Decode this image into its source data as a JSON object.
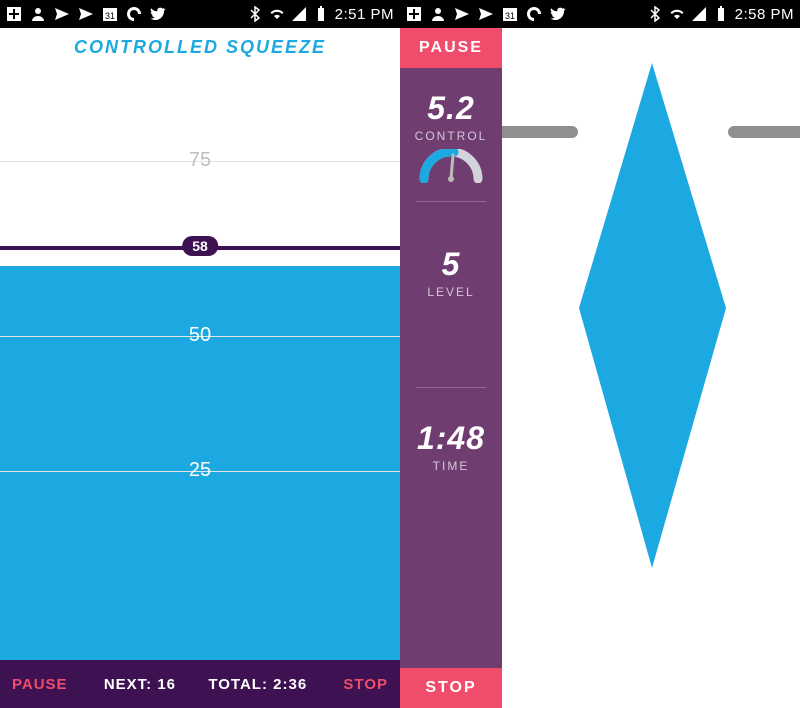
{
  "left": {
    "statusbar": {
      "time": "2:51 PM"
    },
    "title": "CONTROLLED SQUEEZE",
    "chart": {
      "scale_labels": {
        "y75": "75",
        "y50": "50",
        "y25": "25"
      },
      "marker_value": "58"
    },
    "bottombar": {
      "pause": "PAUSE",
      "next_label": "NEXT:",
      "next_value": "16",
      "total_label": "TOTAL:",
      "total_value": "2:36",
      "stop": "STOP"
    }
  },
  "right": {
    "statusbar": {
      "time": "2:58 PM"
    },
    "buttons": {
      "pause": "PAUSE",
      "stop": "STOP"
    },
    "metrics": {
      "control_value": "5.2",
      "control_label": "CONTROL",
      "level_value": "5",
      "level_label": "LEVEL",
      "time_value": "1:48",
      "time_label": "TIME"
    }
  },
  "chart_data": [
    {
      "type": "area",
      "title": "CONTROLLED SQUEEZE",
      "ylabel": "",
      "xlabel": "",
      "ylim": [
        0,
        100
      ],
      "current_value": 58,
      "gridlines": [
        25,
        50,
        75
      ],
      "bottom_readout": {
        "next": 16,
        "total_seconds": 156
      }
    },
    {
      "type": "area",
      "title": "",
      "ylim": [
        0,
        10
      ],
      "series": [
        {
          "name": "CONTROL",
          "value": 5.2
        },
        {
          "name": "LEVEL",
          "value": 5
        }
      ],
      "elapsed_seconds": 108
    }
  ]
}
